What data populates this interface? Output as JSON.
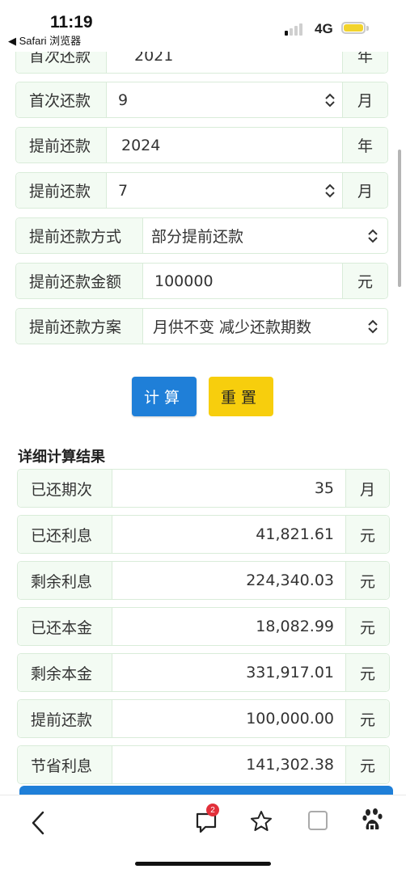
{
  "status": {
    "time": "11:19",
    "back_app": "◀ Safari 浏览器",
    "network": "4G",
    "signal_bars": 1,
    "battery_color": "#f2d32c"
  },
  "form": {
    "partial_top": {
      "label": "首次还款",
      "value": "2021",
      "unit": "年"
    },
    "first_month": {
      "label": "首次还款",
      "value": "9",
      "unit": "月"
    },
    "prepay_year": {
      "label": "提前还款",
      "value": "2024",
      "unit": "年"
    },
    "prepay_month": {
      "label": "提前还款",
      "value": "7",
      "unit": "月"
    },
    "prepay_method": {
      "label": "提前还款方式",
      "value": "部分提前还款"
    },
    "prepay_amount": {
      "label": "提前还款金额",
      "value": "100000",
      "unit": "元"
    },
    "prepay_plan": {
      "label": "提前还款方案",
      "value": "月供不变 减少还款期数"
    }
  },
  "buttons": {
    "calc": "计算",
    "reset": "重置"
  },
  "results": {
    "title": "详细计算结果",
    "rows": [
      {
        "label": "已还期次",
        "value": "35",
        "unit": "月"
      },
      {
        "label": "已还利息",
        "value": "41,821.61",
        "unit": "元"
      },
      {
        "label": "剩余利息",
        "value": "224,340.03",
        "unit": "元"
      },
      {
        "label": "已还本金",
        "value": "18,082.99",
        "unit": "元"
      },
      {
        "label": "剩余本金",
        "value": "331,917.01",
        "unit": "元"
      },
      {
        "label": "提前还款",
        "value": "100,000.00",
        "unit": "元"
      },
      {
        "label": "节省利息",
        "value": "141,302.38",
        "unit": "元"
      }
    ]
  },
  "toolbar": {
    "icons": [
      "back-icon",
      "comments-icon",
      "star-icon",
      "tabs-icon",
      "baidu-paw-icon"
    ],
    "badge_count": "2"
  },
  "colors": {
    "primary": "#1f7fd8",
    "warning": "#f7ce0d",
    "addon_bg": "#f3fbf3",
    "border": "#d9ecd9"
  }
}
